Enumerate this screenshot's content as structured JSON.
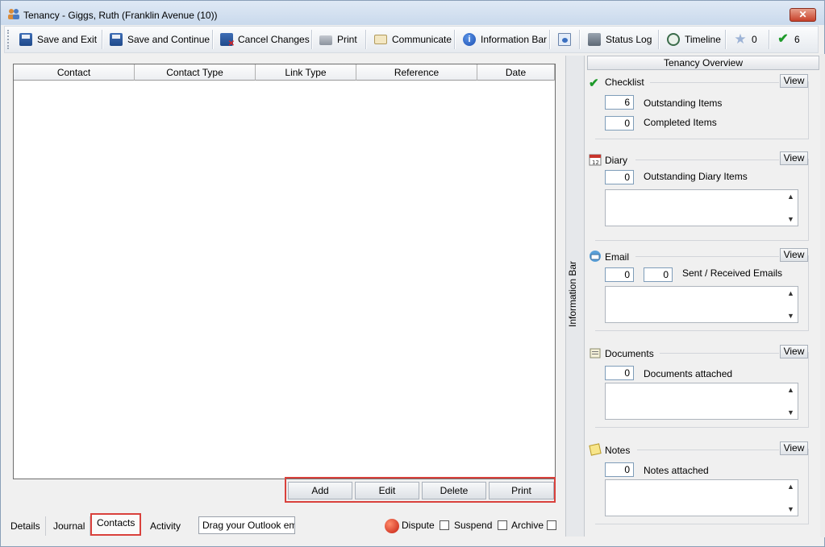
{
  "window": {
    "title": "Tenancy - Giggs, Ruth (Franklin Avenue (10))",
    "close_symbol": "✕"
  },
  "toolbar": {
    "save_exit": "Save and Exit",
    "save_continue": "Save and Continue",
    "cancel_changes": "Cancel Changes",
    "print": "Print",
    "communicate": "Communicate",
    "information_bar": "Information Bar",
    "status_log": "Status Log",
    "timeline": "Timeline",
    "star_count": "0",
    "check_count": "6"
  },
  "grid": {
    "columns": [
      "Contact",
      "Contact Type",
      "Link Type",
      "Reference",
      "Date"
    ],
    "rows": []
  },
  "actions": {
    "add": "Add",
    "edit": "Edit",
    "delete": "Delete",
    "print": "Print"
  },
  "tabs": {
    "details": "Details",
    "journal": "Journal",
    "contacts": "Contacts",
    "activity": "Activity"
  },
  "outlook_drop": "Drag your Outlook email here",
  "status": {
    "dispute": "Dispute",
    "suspend": "Suspend",
    "archive": "Archive"
  },
  "info_bar": {
    "label": "Information Bar",
    "overview_title": "Tenancy Overview",
    "view_label": "View",
    "checklist": {
      "title": "Checklist",
      "outstanding": "6",
      "outstanding_label": "Outstanding Items",
      "completed": "0",
      "completed_label": "Completed Items"
    },
    "diary": {
      "title": "Diary",
      "outstanding": "0",
      "outstanding_label": "Outstanding Diary Items"
    },
    "email": {
      "title": "Email",
      "sent": "0",
      "received": "0",
      "label": "Sent / Received Emails"
    },
    "documents": {
      "title": "Documents",
      "count": "0",
      "label": "Documents attached"
    },
    "notes": {
      "title": "Notes",
      "count": "0",
      "label": "Notes attached"
    }
  },
  "colors": {
    "highlight": "#d9413c",
    "accent": "#1f4a8a"
  }
}
